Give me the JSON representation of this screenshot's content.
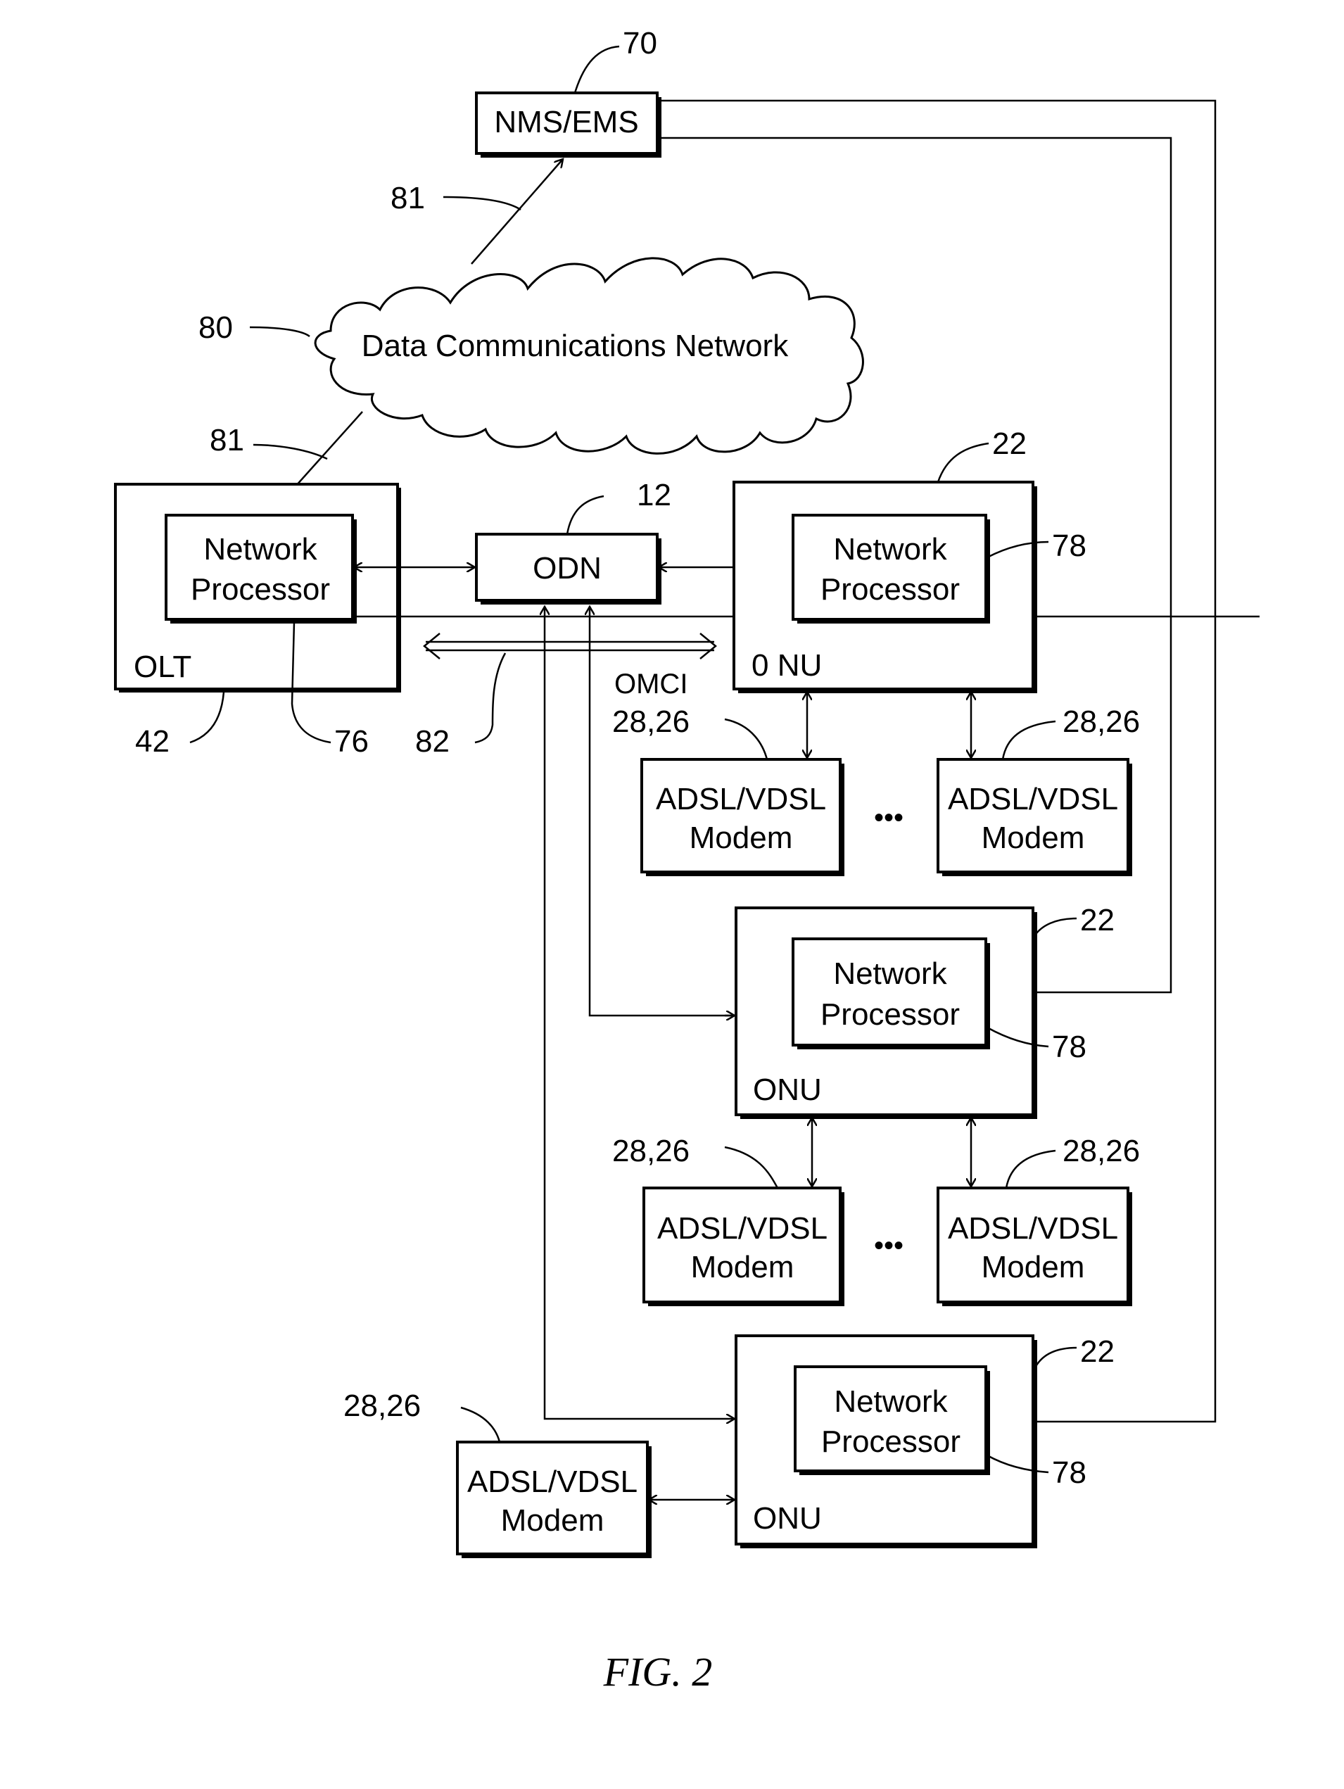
{
  "figure": {
    "caption": "FIG. 2",
    "nodes": {
      "nms": {
        "label": "NMS/EMS",
        "ref": "70"
      },
      "cloud": {
        "label": "Data Communications Network",
        "ref": "80"
      },
      "olt": {
        "label": "OLT",
        "ref": "42",
        "np_label_line1": "Network",
        "np_label_line2": "Processor",
        "np_ref": "76"
      },
      "odn": {
        "label": "ODN",
        "ref": "12"
      },
      "onu1": {
        "label": "0 NU",
        "ref": "22",
        "np_label_line1": "Network",
        "np_label_line2": "Processor",
        "np_ref": "78"
      },
      "onu2": {
        "label": "ONU",
        "ref": "22",
        "np_label_line1": "Network",
        "np_label_line2": "Processor",
        "np_ref": "78"
      },
      "onu3": {
        "label": "ONU",
        "ref": "22",
        "np_label_line1": "Network",
        "np_label_line2": "Processor",
        "np_ref": "78"
      },
      "modem": {
        "line1": "ADSL/VDSL",
        "line2": "Modem",
        "ref": "28,26"
      }
    },
    "links": {
      "dcn_ref_upper": "81",
      "dcn_ref_lower": "81",
      "omci_label": "OMCI",
      "omci_ref": "82"
    },
    "ellipsis": "•••"
  }
}
